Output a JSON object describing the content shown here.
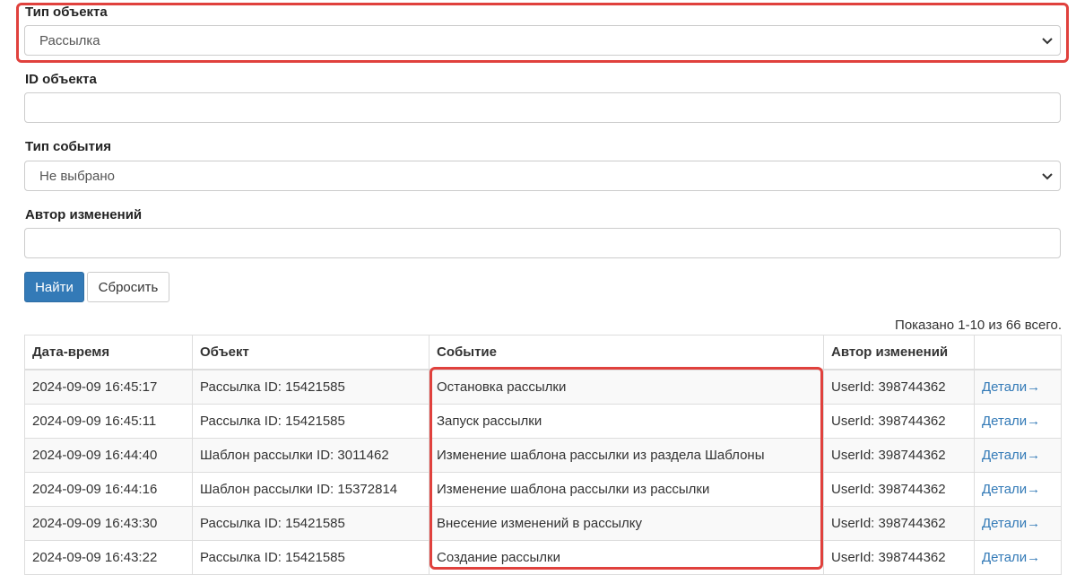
{
  "filters": {
    "object_type": {
      "label": "Тип объекта",
      "value": "Рассылка"
    },
    "object_id": {
      "label": "ID объекта",
      "value": ""
    },
    "event_type": {
      "label": "Тип события",
      "value": "Не выбрано"
    },
    "author": {
      "label": "Автор изменений",
      "value": ""
    }
  },
  "buttons": {
    "search": "Найти",
    "reset": "Сбросить"
  },
  "summary": "Показано 1-10 из 66 всего.",
  "table": {
    "headers": [
      "Дата-время",
      "Объект",
      "Событие",
      "Автор изменений",
      ""
    ],
    "rows": [
      {
        "datetime": "2024-09-09 16:45:17",
        "object": "Рассылка ID: 15421585",
        "event": "Остановка рассылки",
        "author": "UserId: 398744362",
        "details": "Детали→"
      },
      {
        "datetime": "2024-09-09 16:45:11",
        "object": "Рассылка ID: 15421585",
        "event": "Запуск рассылки",
        "author": "UserId: 398744362",
        "details": "Детали→"
      },
      {
        "datetime": "2024-09-09 16:44:40",
        "object": "Шаблон рассылки ID: 3011462",
        "event": "Изменение шаблона рассылки из раздела Шаблоны",
        "author": "UserId: 398744362",
        "details": "Детали→"
      },
      {
        "datetime": "2024-09-09 16:44:16",
        "object": "Шаблон рассылки ID: 15372814",
        "event": "Изменение шаблона рассылки из рассылки",
        "author": "UserId: 398744362",
        "details": "Детали→"
      },
      {
        "datetime": "2024-09-09 16:43:30",
        "object": "Рассылка ID: 15421585",
        "event": "Внесение изменений в рассылку",
        "author": "UserId: 398744362",
        "details": "Детали→"
      },
      {
        "datetime": "2024-09-09 16:43:22",
        "object": "Рассылка ID: 15421585",
        "event": "Создание рассылки",
        "author": "UserId: 398744362",
        "details": "Детали→"
      }
    ]
  },
  "colors": {
    "highlight": "#e0413d",
    "primary": "#337ab7",
    "link": "#337ab7"
  },
  "icons": {
    "select_arrow": "chevron-down-icon",
    "details_arrow": "arrow-right-icon"
  }
}
